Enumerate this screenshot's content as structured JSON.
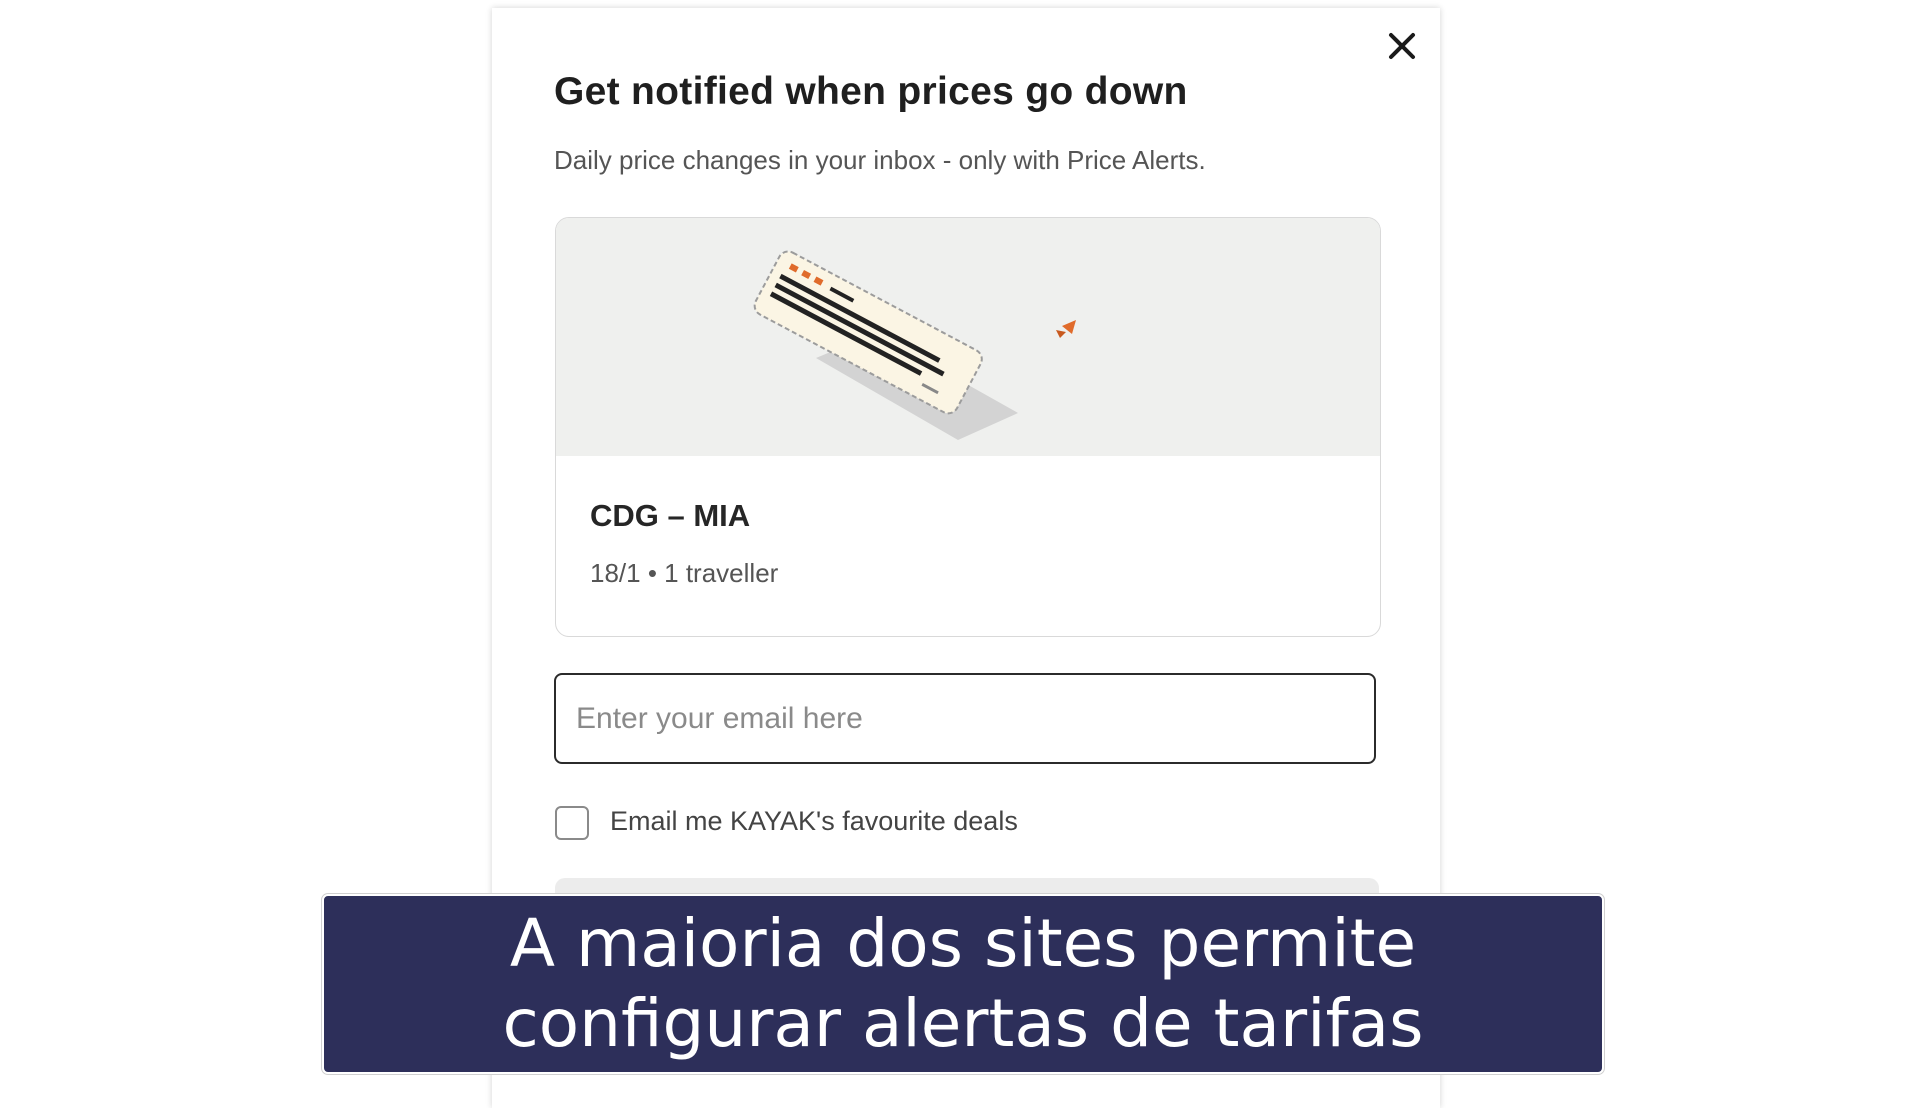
{
  "modal": {
    "title": "Get notified when prices go down",
    "subtitle": "Daily price changes in your inbox - only with Price Alerts.",
    "card": {
      "route": "CDG – MIA",
      "details": "18/1 • 1 traveller"
    },
    "email": {
      "placeholder": "Enter your email here",
      "value": ""
    },
    "checkbox": {
      "label": "Email me KAYAK's favourite deals",
      "checked": false
    },
    "icons": {
      "close": "close-icon",
      "illustration": "boarding-pass-illustration"
    },
    "colors": {
      "accent": "#e06b2b",
      "illustration_bg": "#eff0ee"
    }
  },
  "caption": {
    "line1": "A maioria dos sites permite",
    "line2": "configurar alertas de tarifas",
    "background": "#2d2f5a"
  }
}
